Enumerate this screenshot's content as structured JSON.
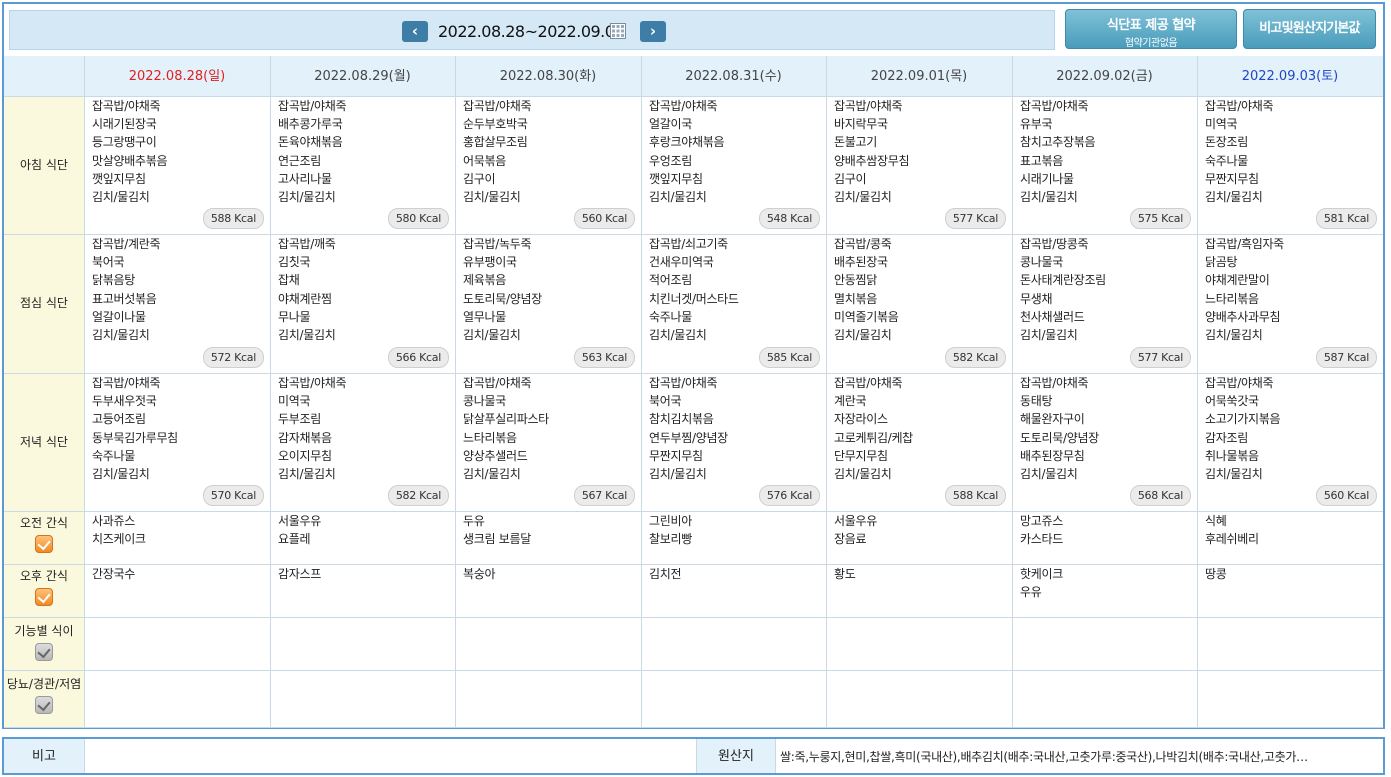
{
  "header": {
    "week_range": "2022.08.28~2022.09.03",
    "agreement_button": "식단표 제공 협약",
    "agreement_sub": "협약기관없음",
    "origin_button": "비고및원산지기본값"
  },
  "days": [
    {
      "label": "2022.08.28(일)",
      "type": "sun"
    },
    {
      "label": "2022.08.29(월)",
      "type": "weekday"
    },
    {
      "label": "2022.08.30(화)",
      "type": "weekday"
    },
    {
      "label": "2022.08.31(수)",
      "type": "weekday"
    },
    {
      "label": "2022.09.01(목)",
      "type": "weekday"
    },
    {
      "label": "2022.09.02(금)",
      "type": "weekday"
    },
    {
      "label": "2022.09.03(토)",
      "type": "sat"
    }
  ],
  "rows": [
    {
      "label": "아침 식단",
      "checkbox": null
    },
    {
      "label": "점심 식단",
      "checkbox": null
    },
    {
      "label": "저녁 식단",
      "checkbox": null
    },
    {
      "label": "오전 간식",
      "checkbox": "on"
    },
    {
      "label": "오후 간식",
      "checkbox": "on"
    },
    {
      "label": "기능별 식이",
      "checkbox": "off"
    },
    {
      "label": "당뇨/경관/저염",
      "checkbox": "off"
    }
  ],
  "meals": {
    "breakfast": [
      {
        "items": [
          "잡곡밥/야채죽",
          "시래기된장국",
          "등그랑땡구이",
          "맛살양배추볶음",
          "깻잎지무침",
          "김치/물김치"
        ],
        "kcal": "588 Kcal"
      },
      {
        "items": [
          "잡곡밥/야채죽",
          "배추콩가루국",
          "돈육야채볶음",
          "연근조림",
          "고사리나물",
          "김치/물김치"
        ],
        "kcal": "580 Kcal"
      },
      {
        "items": [
          "잡곡밥/야채죽",
          "순두부호박국",
          "홍합살무조림",
          "어묵볶음",
          "김구이",
          "김치/물김치"
        ],
        "kcal": "560 Kcal"
      },
      {
        "items": [
          "잡곡밥/야채죽",
          "얼갈이국",
          "후랑크야채볶음",
          "우엉조림",
          "깻잎지무침",
          "김치/물김치"
        ],
        "kcal": "548 Kcal"
      },
      {
        "items": [
          "잡곡밥/야채죽",
          "바지락무국",
          "돈불고기",
          "양배추쌈장무침",
          "김구이",
          "김치/물김치"
        ],
        "kcal": "577 Kcal"
      },
      {
        "items": [
          "잡곡밥/야채죽",
          "유부국",
          "참치고추장볶음",
          "표고볶음",
          "시래기나물",
          "김치/물김치"
        ],
        "kcal": "575 Kcal"
      },
      {
        "items": [
          "잡곡밥/야채죽",
          "미역국",
          "돈장조림",
          "숙주나물",
          "무짠지무침",
          "김치/물김치"
        ],
        "kcal": "581 Kcal"
      }
    ],
    "lunch": [
      {
        "items": [
          "잡곡밥/계란죽",
          "북어국",
          "닭볶음탕",
          "표고버섯볶음",
          "얼갈이나물",
          "김치/물김치"
        ],
        "kcal": "572 Kcal"
      },
      {
        "items": [
          "잡곡밥/깨죽",
          "김칫국",
          "잡채",
          "야채계란찜",
          "무나물",
          "김치/물김치"
        ],
        "kcal": "566 Kcal"
      },
      {
        "items": [
          "잡곡밥/녹두죽",
          "유부팽이국",
          "제육볶음",
          "도토리묵/양념장",
          "열무나물",
          "김치/물김치"
        ],
        "kcal": "563 Kcal"
      },
      {
        "items": [
          "잡곡밥/쇠고기죽",
          "건새우미역국",
          "적어조림",
          "치킨너겟/머스타드",
          "숙주나물",
          "김치/물김치"
        ],
        "kcal": "585 Kcal"
      },
      {
        "items": [
          "잡곡밥/콩죽",
          "배추된장국",
          "안동찜닭",
          "멸치볶음",
          "미역줄기볶음",
          "김치/물김치"
        ],
        "kcal": "582 Kcal"
      },
      {
        "items": [
          "잡곡밥/땅콩죽",
          "콩나물국",
          "돈사태계란장조림",
          "무생채",
          "천사채샐러드",
          "김치/물김치"
        ],
        "kcal": "577 Kcal"
      },
      {
        "items": [
          "잡곡밥/흑임자죽",
          "닭곰탕",
          "야채계란말이",
          "느타리볶음",
          "양배추사과무침",
          "김치/물김치"
        ],
        "kcal": "587 Kcal"
      }
    ],
    "dinner": [
      {
        "items": [
          "잡곡밥/야채죽",
          "두부새우젓국",
          "고등어조림",
          "동부묵김가루무침",
          "숙주나물",
          "김치/물김치"
        ],
        "kcal": "570 Kcal"
      },
      {
        "items": [
          "잡곡밥/야채죽",
          "미역국",
          "두부조림",
          "감자채볶음",
          "오이지무침",
          "김치/물김치"
        ],
        "kcal": "582 Kcal"
      },
      {
        "items": [
          "잡곡밥/야채죽",
          "콩나물국",
          "닭살푸실리파스타",
          "느타리볶음",
          "양상추샐러드",
          "김치/물김치"
        ],
        "kcal": "567 Kcal"
      },
      {
        "items": [
          "잡곡밥/야채죽",
          "북어국",
          "참치김치볶음",
          "연두부찜/양념장",
          "무짠지무침",
          "김치/물김치"
        ],
        "kcal": "576 Kcal"
      },
      {
        "items": [
          "잡곡밥/야채죽",
          "계란국",
          "자장라이스",
          "고로케튀김/케찹",
          "단무지무침",
          "김치/물김치"
        ],
        "kcal": "588 Kcal"
      },
      {
        "items": [
          "잡곡밥/야채죽",
          "동태탕",
          "해물완자구이",
          "도토리묵/양념장",
          "배추된장무침",
          "김치/물김치"
        ],
        "kcal": "568 Kcal"
      },
      {
        "items": [
          "잡곡밥/야채죽",
          "어묵쑥갓국",
          "소고기가지볶음",
          "감자조림",
          "취나물볶음",
          "김치/물김치"
        ],
        "kcal": "560 Kcal"
      }
    ],
    "am_snack": [
      [
        "사과쥬스",
        "치즈케이크"
      ],
      [
        "서울우유",
        "요플레"
      ],
      [
        "두유",
        "생크림 보름달"
      ],
      [
        "그린비아",
        "찰보리빵"
      ],
      [
        "서울우유",
        "장음료"
      ],
      [
        "망고쥬스",
        "카스타드"
      ],
      [
        "식혜",
        "후레쉬베리"
      ]
    ],
    "pm_snack": [
      [
        "간장국수"
      ],
      [
        "감자스프"
      ],
      [
        "복숭아"
      ],
      [
        "김치전"
      ],
      [
        "황도"
      ],
      [
        "핫케이크",
        "우유"
      ],
      [
        "땅콩"
      ]
    ]
  },
  "footer": {
    "remark_label": "비고",
    "remark_value": "",
    "origin_label": "원산지",
    "origin_value": "쌀:죽,누룽지,현미,찹쌀,흑미(국내산),배추김치(배추:국내산,고춧가루:중국산),나박김치(배추:국내산,고춧가…"
  }
}
